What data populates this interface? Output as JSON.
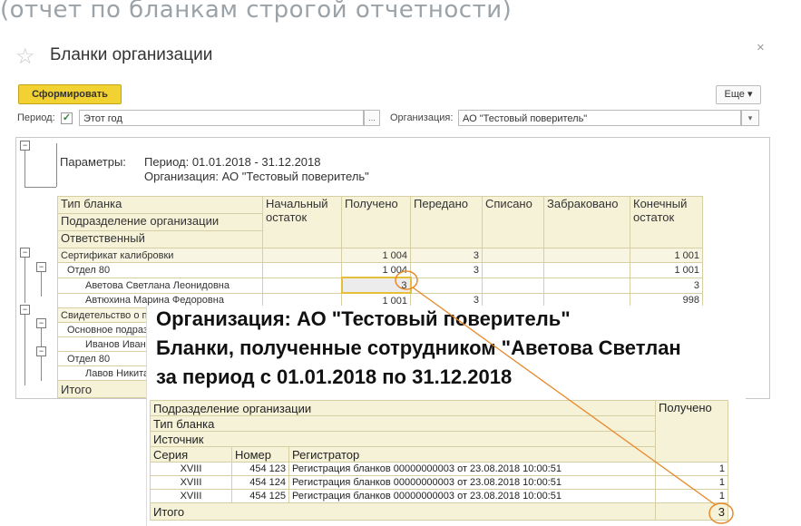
{
  "caption": "(отчет по бланкам строгой отчетности)",
  "window": {
    "title": "Бланки организации",
    "close": "×",
    "generate_button": "Сформировать",
    "more_button": "Еще ▾",
    "period_label": "Период:",
    "period_value": "Этот год",
    "period_select": "...",
    "org_label": "Организация:",
    "org_value": "АО \"Тестовый поверитель\"",
    "dropdown_arrow": "▾"
  },
  "report": {
    "params_label": "Параметры:",
    "params_period": "Период: 01.01.2018 - 31.12.2018",
    "params_org": "Организация: АО \"Тестовый поверитель\"",
    "columns": [
      "Тип бланка",
      "Начальный остаток",
      "Получено",
      "Передано",
      "Списано",
      "Забраковано",
      "Конечный остаток"
    ],
    "header_rows": [
      "Тип бланка",
      "Подразделение организации",
      "Ответственный"
    ],
    "col_begin": "Начальный",
    "col_begin2": "остаток",
    "col_end": "Конечный",
    "col_end2": "остаток",
    "rows": [
      {
        "name": "Сертификат калибровки",
        "begin": "",
        "received": "1 004",
        "passed": "3",
        "written": "",
        "rejected": "",
        "end": "1 001"
      },
      {
        "name": "Отдел 80",
        "begin": "",
        "received": "1 004",
        "passed": "3",
        "written": "",
        "rejected": "",
        "end": "1 001"
      },
      {
        "name": "Аветова Светлана Леонидовна",
        "begin": "",
        "received": "3",
        "passed": "",
        "written": "",
        "rejected": "",
        "end": "3"
      },
      {
        "name": "Автюхина Марина Федоровна",
        "begin": "",
        "received": "1 001",
        "passed": "3",
        "written": "",
        "rejected": "",
        "end": "998"
      },
      {
        "name": "Свидетельство о поверке",
        "begin": "",
        "received": "",
        "passed": "",
        "written": "",
        "rejected": "",
        "end": ""
      },
      {
        "name": "Основное подразделение",
        "begin": "",
        "received": "",
        "passed": "",
        "written": "",
        "rejected": "",
        "end": ""
      },
      {
        "name": "Иванов Иван",
        "begin": "",
        "received": "",
        "passed": "",
        "written": "",
        "rejected": "",
        "end": ""
      },
      {
        "name": "Отдел 80",
        "begin": "",
        "received": "",
        "passed": "",
        "written": "",
        "rejected": "",
        "end": ""
      },
      {
        "name": "Лавов Никита",
        "begin": "",
        "received": "",
        "passed": "",
        "written": "",
        "rejected": "",
        "end": ""
      }
    ],
    "total_label": "Итого"
  },
  "detail": {
    "line1": "Организация: АО \"Тестовый поверитель\"",
    "line2": "Бланки, полученные сотрудником \"Аветова Светлан",
    "line3": "за период с 01.01.2018 по 31.12.2018",
    "header_rows": [
      "Подразделение организации",
      "Тип бланка",
      "Источник"
    ],
    "col_received": "Получено",
    "col_series": "Серия",
    "col_number": "Номер",
    "col_registrar": "Регистратор",
    "rows": [
      {
        "series": "XVIII",
        "number": "454 123",
        "registrar": "Регистрация бланков 00000000003 от 23.08.2018 10:00:51",
        "received": "1"
      },
      {
        "series": "XVIII",
        "number": "454 124",
        "registrar": "Регистрация бланков 00000000003 от 23.08.2018 10:00:51",
        "received": "1"
      },
      {
        "series": "XVIII",
        "number": "454 125",
        "registrar": "Регистрация бланков 00000000003 от 23.08.2018 10:00:51",
        "received": "1"
      }
    ],
    "total_label": "Итого",
    "total_value": "3"
  },
  "colors": {
    "accent_button": "#f2d233",
    "annotation": "#e8892b",
    "header_fill": "#f6f2d8"
  },
  "icons": [
    "star-icon",
    "close-icon",
    "checkbox-icon",
    "collapse-icon"
  ]
}
